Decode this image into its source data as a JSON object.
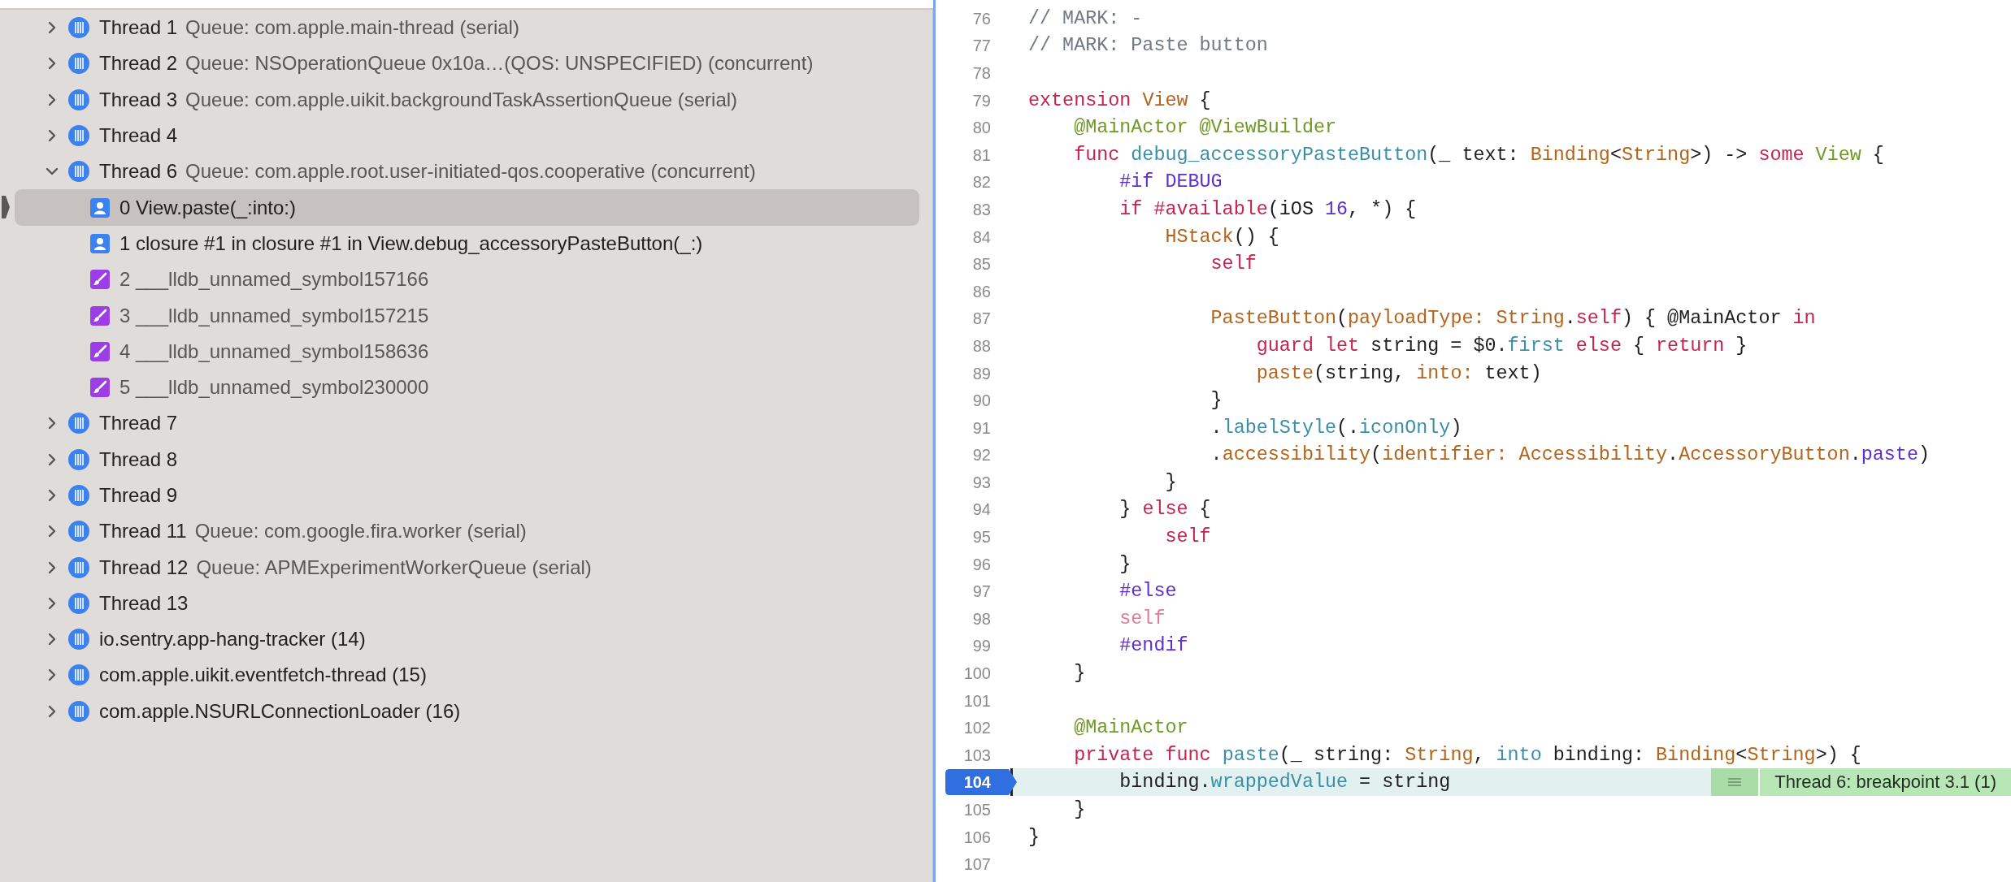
{
  "debug_navigator": {
    "threads": [
      {
        "name": "Thread 1",
        "queue": "Queue: com.apple.main-thread (serial)",
        "expanded": false
      },
      {
        "name": "Thread 2",
        "queue": "Queue: NSOperationQueue 0x10a…(QOS: UNSPECIFIED) (concurrent)",
        "expanded": false
      },
      {
        "name": "Thread 3",
        "queue": "Queue: com.apple.uikit.backgroundTaskAssertionQueue (serial)",
        "expanded": false
      },
      {
        "name": "Thread 4",
        "expanded": false
      },
      {
        "name": "Thread 6",
        "queue": "Queue: com.apple.root.user-initiated-qos.cooperative (concurrent)",
        "expanded": true,
        "children": [
          {
            "label": "0 View.paste(_:into:)",
            "kind": "user",
            "selected": true
          },
          {
            "label": "1 closure #1 in closure #1 in View.debug_accessoryPasteButton(_:)",
            "kind": "user",
            "selected": false
          },
          {
            "label": "2 ___lldb_unnamed_symbol157166",
            "kind": "system",
            "selected": false
          },
          {
            "label": "3 ___lldb_unnamed_symbol157215",
            "kind": "system",
            "selected": false
          },
          {
            "label": "4 ___lldb_unnamed_symbol158636",
            "kind": "system",
            "selected": false
          },
          {
            "label": "5 ___lldb_unnamed_symbol230000",
            "kind": "system",
            "selected": false
          }
        ]
      },
      {
        "name": "Thread 7",
        "expanded": false
      },
      {
        "name": "Thread 8",
        "expanded": false
      },
      {
        "name": "Thread 9",
        "expanded": false
      },
      {
        "name": "Thread 11",
        "queue": "Queue: com.google.fira.worker (serial)",
        "expanded": false
      },
      {
        "name": "Thread 12",
        "queue": "Queue: APMExperimentWorkerQueue (serial)",
        "expanded": false
      },
      {
        "name": "Thread 13",
        "expanded": false
      },
      {
        "name": "io.sentry.app-hang-tracker (14)",
        "expanded": false
      },
      {
        "name": "com.apple.uikit.eventfetch-thread (15)",
        "expanded": false
      },
      {
        "name": "com.apple.NSURLConnectionLoader (16)",
        "expanded": false
      }
    ]
  },
  "editor": {
    "lines": [
      {
        "number": "76",
        "current": false,
        "tokens": [
          {
            "kind": "comment",
            "text": "// MARK: -"
          }
        ]
      },
      {
        "number": "77",
        "current": false,
        "tokens": [
          {
            "kind": "comment",
            "text": "// MARK: Paste button"
          }
        ]
      },
      {
        "number": "78",
        "current": false
      },
      {
        "number": "79",
        "current": false,
        "tokens": [
          {
            "kind": "keyword",
            "text": "extension"
          },
          {
            "kind": "type",
            "text": " View"
          },
          {
            "kind": "plain",
            "text": " {"
          }
        ]
      },
      {
        "number": "80",
        "current": false,
        "tokens": [
          {
            "kind": "attr",
            "text": "    @MainActor @ViewBuilder"
          }
        ]
      },
      {
        "number": "81",
        "current": false,
        "tokens": [
          {
            "kind": "keyword",
            "text": "    func"
          },
          {
            "kind": "func",
            "text": " debug_accessoryPasteButton"
          },
          {
            "kind": "plain",
            "text": "(_ text: "
          },
          {
            "kind": "type",
            "text": "Binding"
          },
          {
            "kind": "plain",
            "text": "<"
          },
          {
            "kind": "type",
            "text": "String"
          },
          {
            "kind": "plain",
            "text": ">) -> "
          },
          {
            "kind": "keyword",
            "text": "some"
          },
          {
            "kind": "attr",
            "text": " View"
          },
          {
            "kind": "plain",
            "text": " {"
          }
        ]
      },
      {
        "number": "82",
        "current": false,
        "tokens": [
          {
            "kind": "preproc",
            "text": "        #if DEBUG"
          }
        ]
      },
      {
        "number": "83",
        "current": false,
        "tokens": [
          {
            "kind": "keyword",
            "text": "        if #available"
          },
          {
            "kind": "plain",
            "text": "(iOS "
          },
          {
            "kind": "preproc",
            "text": "16"
          },
          {
            "kind": "plain",
            "text": ", *) {"
          }
        ]
      },
      {
        "number": "84",
        "current": false,
        "tokens": [
          {
            "kind": "type",
            "text": "            HStack"
          },
          {
            "kind": "plain",
            "text": "() {"
          }
        ]
      },
      {
        "number": "85",
        "current": false,
        "tokens": [
          {
            "kind": "keyword",
            "text": "                self"
          }
        ]
      },
      {
        "number": "86",
        "current": false
      },
      {
        "number": "87",
        "current": false,
        "tokens": [
          {
            "kind": "type",
            "text": "                PasteButton"
          },
          {
            "kind": "plain",
            "text": "("
          },
          {
            "kind": "type",
            "text": "payloadType: String"
          },
          {
            "kind": "plain",
            "text": "."
          },
          {
            "kind": "keyword",
            "text": "self"
          },
          {
            "kind": "plain",
            "text": ") { @MainActor "
          },
          {
            "kind": "keyword",
            "text": "in"
          }
        ]
      },
      {
        "number": "88",
        "current": false,
        "tokens": [
          {
            "kind": "keyword",
            "text": "                    guard let"
          },
          {
            "kind": "plain",
            "text": " string = $0."
          },
          {
            "kind": "func",
            "text": "first"
          },
          {
            "kind": "keyword",
            "text": " else"
          },
          {
            "kind": "plain",
            "text": " { "
          },
          {
            "kind": "keyword",
            "text": "return"
          },
          {
            "kind": "plain",
            "text": " }"
          }
        ]
      },
      {
        "number": "89",
        "current": false,
        "tokens": [
          {
            "kind": "type",
            "text": "                    paste"
          },
          {
            "kind": "plain",
            "text": "(string, "
          },
          {
            "kind": "type",
            "text": "into:"
          },
          {
            "kind": "plain",
            "text": " text)"
          }
        ]
      },
      {
        "number": "90",
        "current": false,
        "tokens": [
          {
            "kind": "plain",
            "text": "                }"
          }
        ]
      },
      {
        "number": "91",
        "current": false,
        "tokens": [
          {
            "kind": "plain",
            "text": "                ."
          },
          {
            "kind": "func",
            "text": "labelStyle"
          },
          {
            "kind": "plain",
            "text": "(."
          },
          {
            "kind": "func",
            "text": "iconOnly"
          },
          {
            "kind": "plain",
            "text": ")"
          }
        ]
      },
      {
        "number": "92",
        "current": false,
        "tokens": [
          {
            "kind": "plain",
            "text": "                ."
          },
          {
            "kind": "type",
            "text": "accessibility"
          },
          {
            "kind": "plain",
            "text": "("
          },
          {
            "kind": "type",
            "text": "identifier: Accessibility"
          },
          {
            "kind": "plain",
            "text": "."
          },
          {
            "kind": "type",
            "text": "AccessoryButton"
          },
          {
            "kind": "plain",
            "text": "."
          },
          {
            "kind": "preproc",
            "text": "paste"
          },
          {
            "kind": "plain",
            "text": ")"
          }
        ]
      },
      {
        "number": "93",
        "current": false,
        "tokens": [
          {
            "kind": "plain",
            "text": "            }"
          }
        ]
      },
      {
        "number": "94",
        "current": false,
        "tokens": [
          {
            "kind": "plain",
            "text": "        } "
          },
          {
            "kind": "keyword",
            "text": "else"
          },
          {
            "kind": "plain",
            "text": " {"
          }
        ]
      },
      {
        "number": "95",
        "current": false,
        "tokens": [
          {
            "kind": "keyword",
            "text": "            self"
          }
        ]
      },
      {
        "number": "96",
        "current": false,
        "tokens": [
          {
            "kind": "plain",
            "text": "        }"
          }
        ]
      },
      {
        "number": "97",
        "current": false,
        "tokens": [
          {
            "kind": "preproc",
            "text": "        #else"
          }
        ]
      },
      {
        "number": "98",
        "current": false,
        "tokens": [
          {
            "kind": "inactive",
            "text": "        self"
          }
        ]
      },
      {
        "number": "99",
        "current": false,
        "tokens": [
          {
            "kind": "preproc",
            "text": "        #endif"
          }
        ]
      },
      {
        "number": "100",
        "current": false,
        "tokens": [
          {
            "kind": "plain",
            "text": "    }"
          }
        ]
      },
      {
        "number": "101",
        "current": false
      },
      {
        "number": "102",
        "current": false,
        "tokens": [
          {
            "kind": "attr",
            "text": "    @MainActor"
          }
        ]
      },
      {
        "number": "103",
        "current": false,
        "tokens": [
          {
            "kind": "keyword",
            "text": "    private func"
          },
          {
            "kind": "func",
            "text": " paste"
          },
          {
            "kind": "plain",
            "text": "(_ string: "
          },
          {
            "kind": "type",
            "text": "String"
          },
          {
            "kind": "plain",
            "text": ", "
          },
          {
            "kind": "func",
            "text": "into"
          },
          {
            "kind": "plain",
            "text": " binding: "
          },
          {
            "kind": "type",
            "text": "Binding"
          },
          {
            "kind": "plain",
            "text": "<"
          },
          {
            "kind": "type",
            "text": "String"
          },
          {
            "kind": "plain",
            "text": ">) {"
          }
        ]
      },
      {
        "number": "104",
        "current": true,
        "annotation": "Thread 6: breakpoint 3.1 (1)",
        "tokens": [
          {
            "kind": "plain",
            "text": "        binding."
          },
          {
            "kind": "func",
            "text": "wrappedValue"
          },
          {
            "kind": "plain",
            "text": " = string"
          }
        ]
      },
      {
        "number": "105",
        "current": false,
        "tokens": [
          {
            "kind": "plain",
            "text": "    }"
          }
        ]
      },
      {
        "number": "106",
        "current": false,
        "tokens": [
          {
            "kind": "plain",
            "text": "}"
          }
        ]
      },
      {
        "number": "107",
        "current": false
      }
    ]
  }
}
